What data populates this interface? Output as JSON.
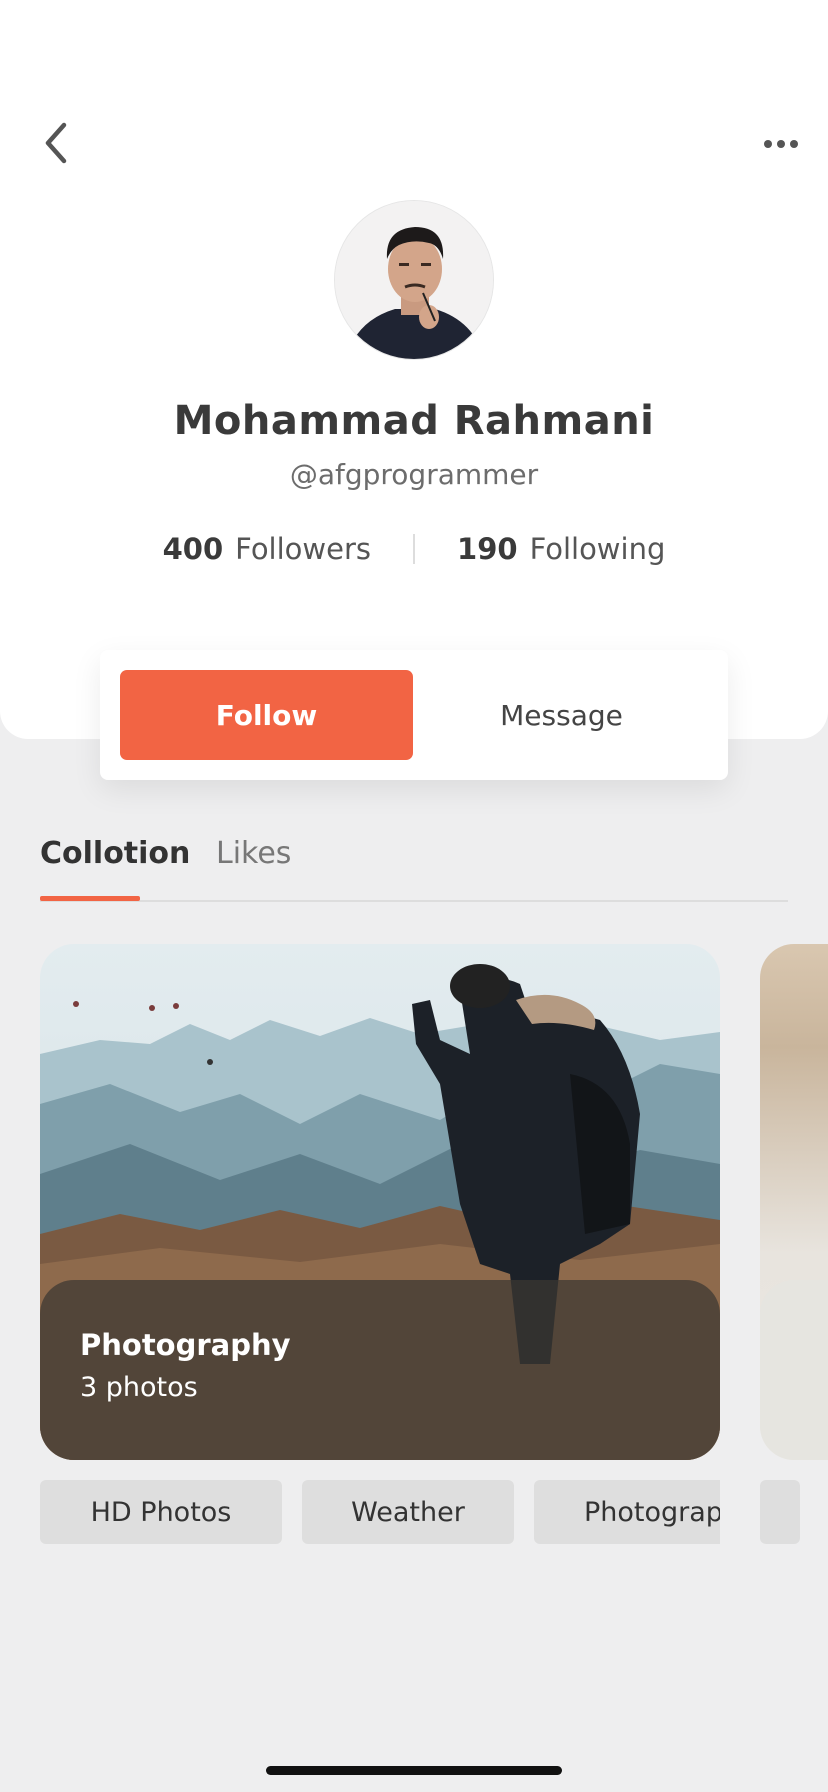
{
  "profile": {
    "name": "Mohammad Rahmani",
    "handle": "@afgprogrammer",
    "followers_count": "400",
    "followers_label": "Followers",
    "following_count": "190",
    "following_label": "Following"
  },
  "actions": {
    "follow_label": "Follow",
    "message_label": "Message"
  },
  "tabs": [
    {
      "label": "Collotion",
      "active": true
    },
    {
      "label": "Likes",
      "active": false
    }
  ],
  "collection": {
    "title": "Photography",
    "subtitle": "3 photos"
  },
  "tags": [
    "HD Photos",
    "Weather",
    "Photograp"
  ],
  "icons": {
    "back": "chevron-left-icon",
    "more": "more-horizontal-icon"
  },
  "colors": {
    "accent": "#f26444",
    "background": "#eeeeef"
  }
}
